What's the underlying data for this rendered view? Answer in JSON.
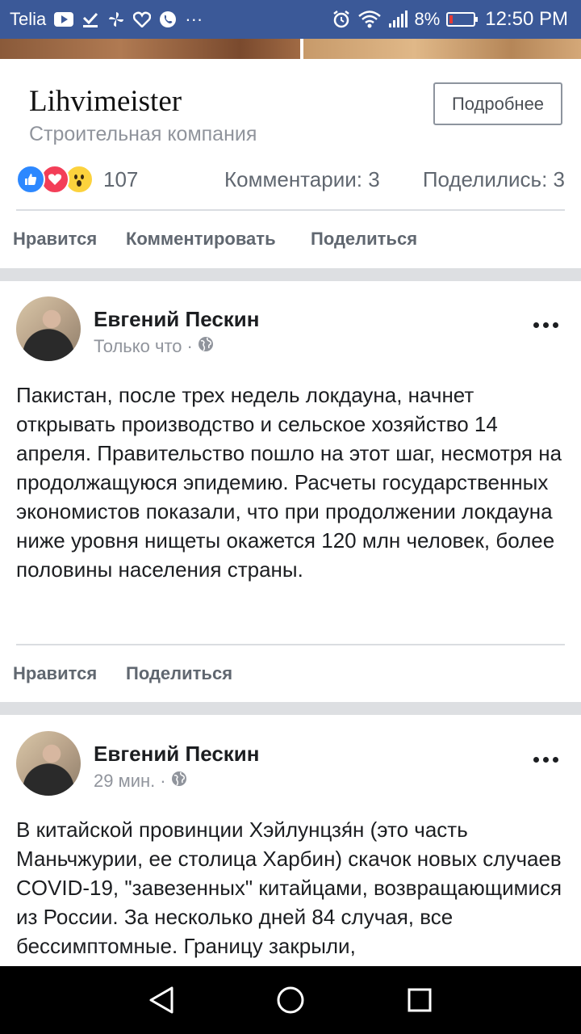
{
  "status_bar": {
    "carrier": "Telia",
    "battery": "8%",
    "time": "12:50 PM"
  },
  "page_card": {
    "name": "Lihvimeister",
    "category": "Строительная компания",
    "more_button": "Подробнее",
    "reaction_count": "107",
    "comments": "Комментарии: 3",
    "shares": "Поделились: 3",
    "actions": {
      "like": "Нравится",
      "comment": "Комментировать",
      "share": "Поделиться"
    }
  },
  "posts": [
    {
      "author": "Евгений Пескин",
      "time": "Только что",
      "dot": "·",
      "text": "Пакистан, после трех недель локдауна, начнет открывать производство и сельское хозяйство 14 апреля. Правительство пошло на этот шаг, несмотря на продолжащуюся эпидемию. Расчеты государственных экономистов показали, что при продолжении локдауна ниже уровня нищеты окажется 120 млн человек, более половины населения страны.",
      "actions": {
        "like": "Нравится",
        "share": "Поделиться"
      }
    },
    {
      "author": "Евгений Пескин",
      "time": "29 мин.",
      "dot": "·",
      "text": "В китайской провинции Хэйлунцзя́н (это часть Маньчжурии, ее столица Харбин) скачок новых случаев COVID-19, \"завезенных\" китайцами, возвращающимися из России. За несколько дней 84 случая, все бессимптомные. Границу закрыли,"
    }
  ]
}
